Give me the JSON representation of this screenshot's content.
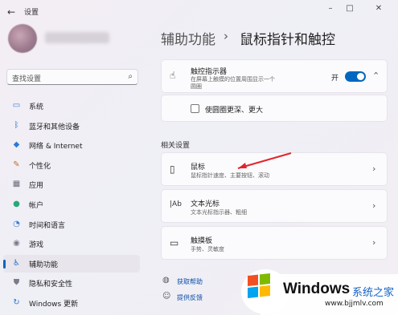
{
  "window": {
    "title": "设置",
    "back": "←",
    "controls": [
      "–",
      "□",
      "✕"
    ]
  },
  "search": {
    "placeholder": "查找设置"
  },
  "nav": [
    {
      "label": "系统",
      "icon": "monitor-icon",
      "glyph": "▭",
      "color": "#3b7fd4"
    },
    {
      "label": "蓝牙和其他设备",
      "icon": "bluetooth-icon",
      "glyph": "ᛒ",
      "color": "#1f6fd1"
    },
    {
      "label": "网络 & Internet",
      "icon": "wifi-icon",
      "glyph": "◆",
      "color": "#2a7bd6"
    },
    {
      "label": "个性化",
      "icon": "brush-icon",
      "glyph": "✎",
      "color": "#c56b2a"
    },
    {
      "label": "应用",
      "icon": "apps-icon",
      "glyph": "▦",
      "color": "#6b6b7b"
    },
    {
      "label": "帐户",
      "icon": "account-icon",
      "glyph": "●",
      "color": "#2aa87a"
    },
    {
      "label": "时间和语言",
      "icon": "globe-clock-icon",
      "glyph": "◔",
      "color": "#2a7bd6"
    },
    {
      "label": "游戏",
      "icon": "gamepad-icon",
      "glyph": "◉",
      "color": "#7b7b8b"
    },
    {
      "label": "辅助功能",
      "icon": "accessibility-icon",
      "glyph": "♿",
      "color": "#1f6fd1"
    },
    {
      "label": "隐私和安全性",
      "icon": "shield-icon",
      "glyph": "⛊",
      "color": "#7b7b8b"
    },
    {
      "label": "Windows 更新",
      "icon": "update-icon",
      "glyph": "↻",
      "color": "#2a7bd6"
    }
  ],
  "nav_selected_index": 8,
  "breadcrumb": {
    "parent": "辅助功能",
    "separator": "›",
    "current": "鼠标指针和触控"
  },
  "touch_indicator": {
    "title": "触控指示器",
    "subtitle_line1": "在屏幕上触摸的位置周围显示一个",
    "subtitle_line2": "圆圈",
    "state_label": "开",
    "enabled": true,
    "expand_glyph": "⌃"
  },
  "touch_option": {
    "label": "使圆圈更深、更大",
    "checked": false
  },
  "related_heading": "相关设置",
  "related": [
    {
      "title": "鼠标",
      "subtitle": "鼠标指针速度、主要按钮、滚动",
      "icon": "mouse-icon",
      "glyph": "▯"
    },
    {
      "title": "文本光标",
      "subtitle": "文本光标指示器、粗细",
      "icon": "text-cursor-icon",
      "glyph": "|Ab"
    },
    {
      "title": "触摸板",
      "subtitle": "手势、灵敏度",
      "icon": "touchpad-icon",
      "glyph": "▭"
    }
  ],
  "chevron": "›",
  "links": [
    {
      "label": "获取帮助",
      "icon": "help-icon",
      "glyph": "◍"
    },
    {
      "label": "提供反馈",
      "icon": "feedback-icon",
      "glyph": "☺"
    }
  ],
  "watermark": {
    "brand": "Windows",
    "cn": "系统之家",
    "url": "www.bjjmlv.com"
  }
}
